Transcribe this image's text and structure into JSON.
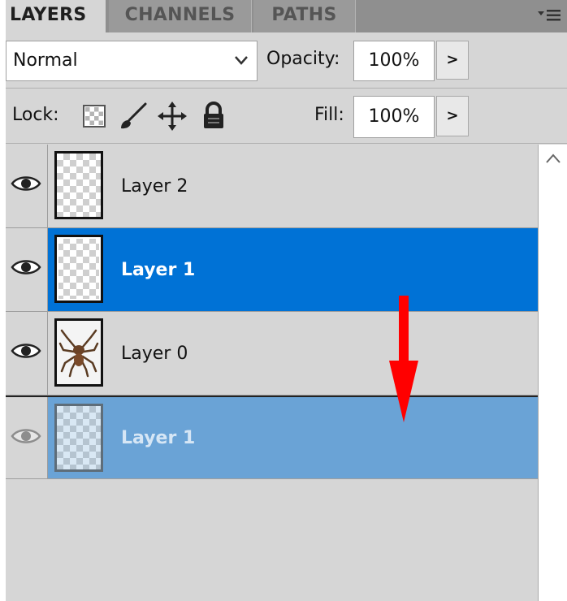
{
  "tabs": [
    {
      "label": "LAYERS",
      "active": true
    },
    {
      "label": "CHANNELS",
      "active": false
    },
    {
      "label": "PATHS",
      "active": false
    }
  ],
  "panel_menu_icon": "panel-menu-icon",
  "blend": {
    "mode": "Normal"
  },
  "opacity": {
    "label": "Opacity:",
    "value": "100%",
    "arrow": ">"
  },
  "lock": {
    "label": "Lock:",
    "icons": [
      "lock-transparent-icon",
      "lock-brush-icon",
      "lock-move-icon",
      "lock-all-icon"
    ]
  },
  "fill": {
    "label": "Fill:",
    "value": "100%",
    "arrow": ">"
  },
  "layers": [
    {
      "name": "Layer 2",
      "visible": true,
      "selected": false,
      "thumbnail": "transparent"
    },
    {
      "name": "Layer 1",
      "visible": true,
      "selected": true,
      "thumbnail": "transparent"
    },
    {
      "name": "Layer 0",
      "visible": true,
      "selected": false,
      "thumbnail": "spider"
    }
  ],
  "drag_ghost": {
    "name": "Layer 1"
  },
  "colors": {
    "selection": "#0072d6",
    "drag_ghost": "#6aa3d6",
    "annotation_arrow": "#ff0000"
  }
}
